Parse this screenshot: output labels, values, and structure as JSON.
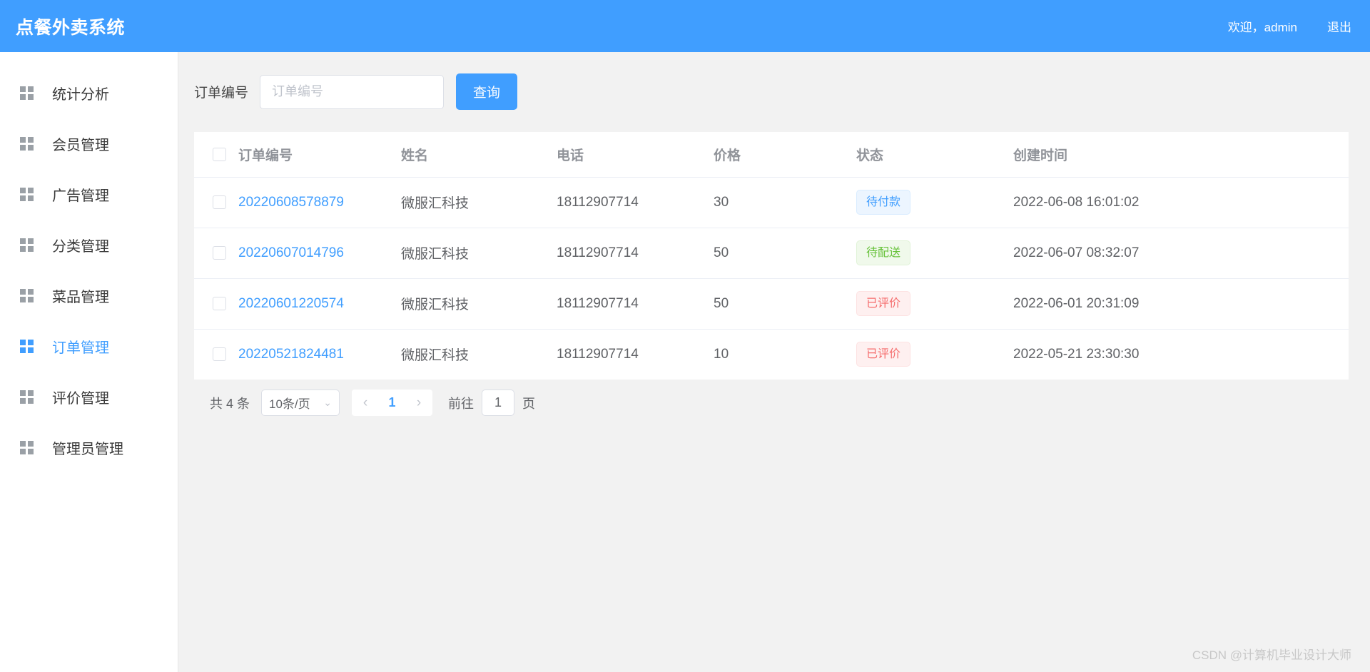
{
  "header": {
    "brand": "点餐外卖系统",
    "welcome": "欢迎，admin",
    "logout": "退出"
  },
  "sidebar": {
    "items": [
      {
        "label": "统计分析",
        "active": false
      },
      {
        "label": "会员管理",
        "active": false
      },
      {
        "label": "广告管理",
        "active": false
      },
      {
        "label": "分类管理",
        "active": false
      },
      {
        "label": "菜品管理",
        "active": false
      },
      {
        "label": "订单管理",
        "active": true
      },
      {
        "label": "评价管理",
        "active": false
      },
      {
        "label": "管理员管理",
        "active": false
      }
    ]
  },
  "search": {
    "label": "订单编号",
    "placeholder": "订单编号",
    "value": "",
    "button": "查询"
  },
  "table": {
    "columns": [
      "订单编号",
      "姓名",
      "电话",
      "价格",
      "状态",
      "创建时间"
    ],
    "rows": [
      {
        "order_no": "20220608578879",
        "name": "微服汇科技",
        "phone": "18112907714",
        "price": "30",
        "status": "待付款",
        "status_type": "primary",
        "created_at": "2022-06-08 16:01:02"
      },
      {
        "order_no": "20220607014796",
        "name": "微服汇科技",
        "phone": "18112907714",
        "price": "50",
        "status": "待配送",
        "status_type": "success",
        "created_at": "2022-06-07 08:32:07"
      },
      {
        "order_no": "20220601220574",
        "name": "微服汇科技",
        "phone": "18112907714",
        "price": "50",
        "status": "已评价",
        "status_type": "danger",
        "created_at": "2022-06-01 20:31:09"
      },
      {
        "order_no": "20220521824481",
        "name": "微服汇科技",
        "phone": "18112907714",
        "price": "10",
        "status": "已评价",
        "status_type": "danger",
        "created_at": "2022-05-21 23:30:30"
      }
    ]
  },
  "pagination": {
    "total_text": "共 4 条",
    "page_size": "10条/页",
    "prev": "‹",
    "next": "›",
    "current_page": "1",
    "goto_label": "前往",
    "jump_value": "1",
    "page_unit": "页"
  },
  "watermark": "CSDN @计算机毕业设计大师",
  "colors": {
    "primary": "#409eff",
    "page_bg": "#f2f2f2",
    "badge_primary": "#409eff",
    "badge_success": "#67c23a",
    "badge_danger": "#f56c6c"
  }
}
